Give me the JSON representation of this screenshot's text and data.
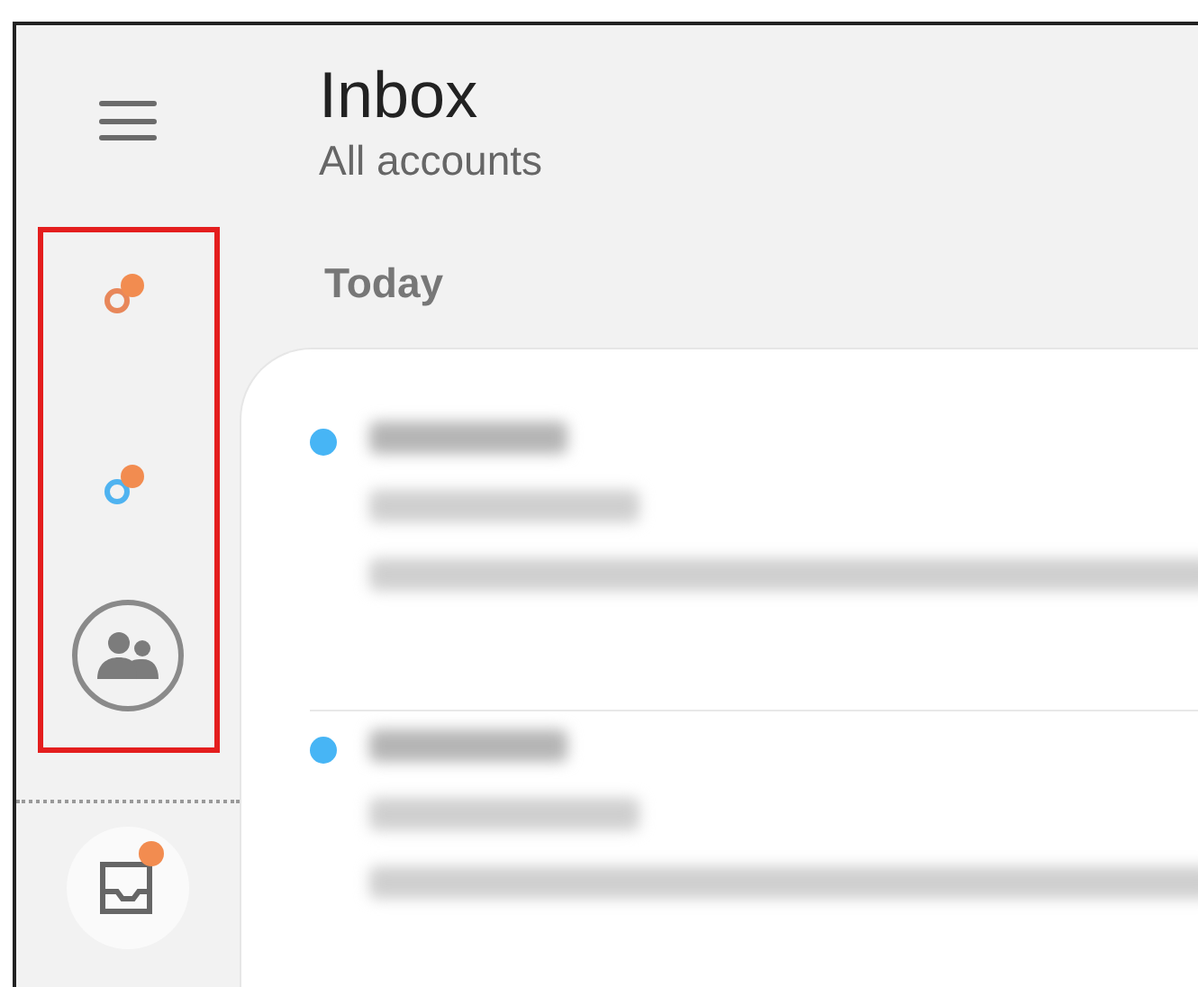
{
  "header": {
    "title": "Inbox",
    "subtitle": "All accounts"
  },
  "sidebar": {
    "accounts": [
      {
        "color": "#e8875a",
        "unread_badge": true
      },
      {
        "color": "#4fb3f0",
        "unread_badge": true
      }
    ],
    "inbox_badge": true,
    "highlighted": true
  },
  "section": "Today",
  "emails": [
    {
      "unread": true
    },
    {
      "unread": true
    }
  ]
}
